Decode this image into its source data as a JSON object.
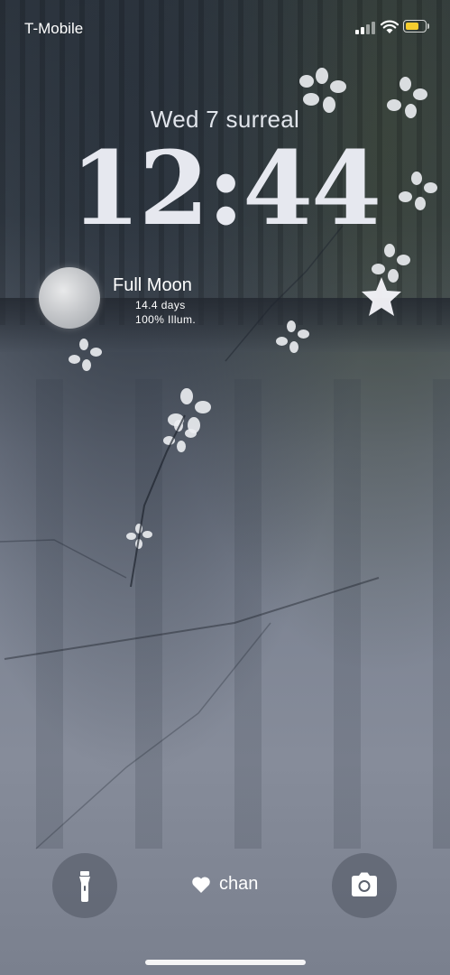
{
  "status_bar": {
    "carrier": "T-Mobile",
    "battery_color": "#f5cd2f",
    "battery_level": 0.75
  },
  "lock_screen": {
    "date": "Wed 7  surreal",
    "time": "12:44"
  },
  "moon_widget": {
    "title": "Full Moon",
    "age": "14.4 days",
    "illumination": "100% Illum."
  },
  "bottom_bar": {
    "left_button_icon": "flashlight-icon",
    "right_button_icon": "camera-icon",
    "center_icon": "heart-icon",
    "center_label": "chan"
  }
}
